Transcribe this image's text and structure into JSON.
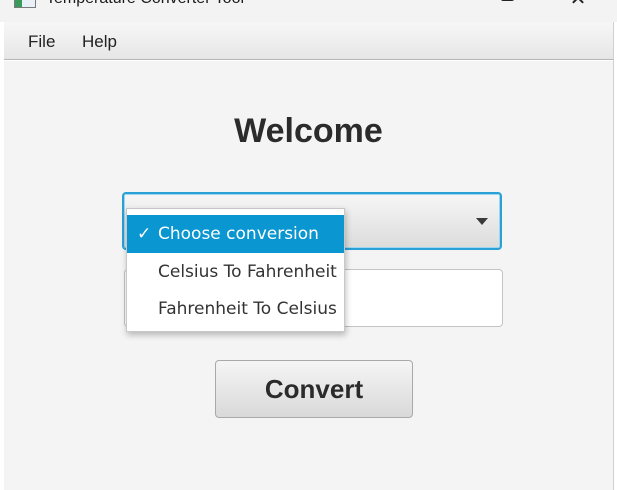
{
  "window": {
    "title": "Temperature Converter Tool",
    "controls": {
      "minimize": "—",
      "close": "✕"
    }
  },
  "menubar": {
    "items": [
      {
        "label": "File"
      },
      {
        "label": "Help"
      }
    ]
  },
  "main": {
    "heading": "Welcome",
    "conversion_select": {
      "selected": "Choose conversion",
      "options": [
        {
          "label": "Choose conversion",
          "selected": true,
          "check": "✓"
        },
        {
          "label": "Celsius To Fahrenheit",
          "selected": false
        },
        {
          "label": "Fahrenheit To Celsius",
          "selected": false
        }
      ]
    },
    "input": {
      "value": ""
    },
    "convert_button": {
      "label": "Convert"
    }
  },
  "colors": {
    "accent": "#0a96d0",
    "focus_border": "#2aa0d6",
    "background": "#f4f4f4"
  }
}
